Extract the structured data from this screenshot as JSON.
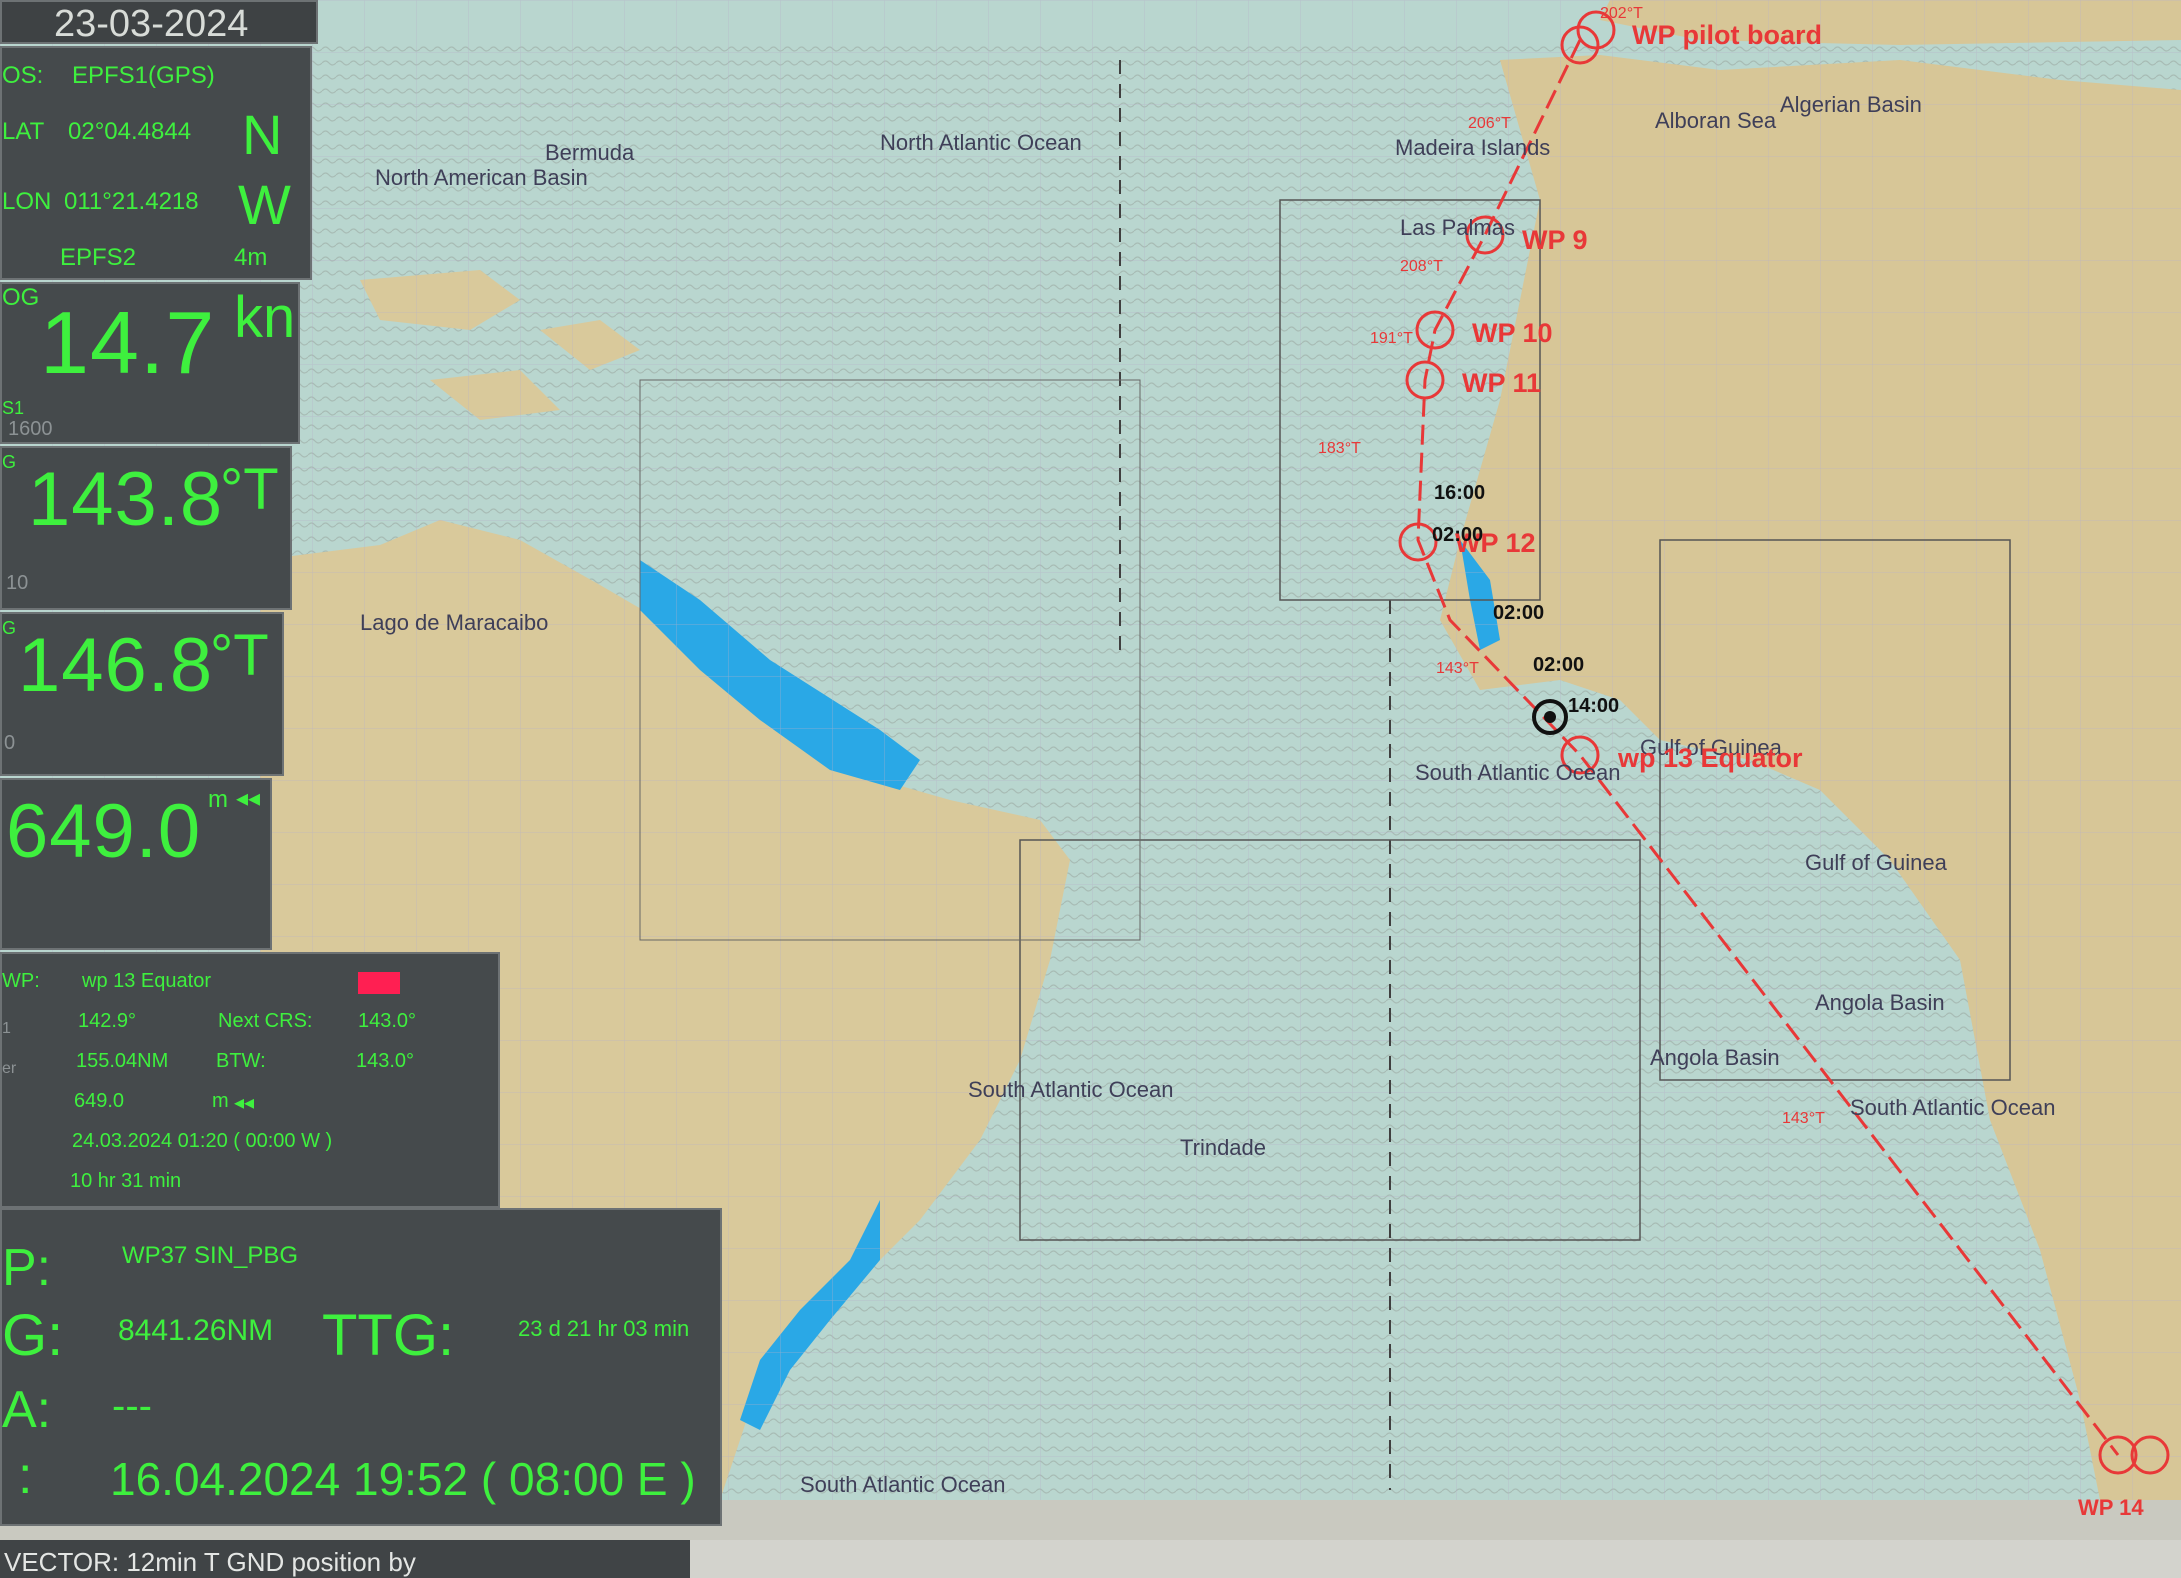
{
  "date": "23-03-2024",
  "position": {
    "pos_label": "OS:",
    "pos_source": "EPFS1(GPS)",
    "lat_label": "LAT",
    "lat_value": "02°04.4844",
    "lat_hemi": "N",
    "lon_label": "LON",
    "lon_value": "011°21.4218",
    "lon_hemi": "W",
    "secondary_source": "EPFS2",
    "secondary_offset": "4m"
  },
  "sog": {
    "label": "OG",
    "value": "14.7",
    "unit": "kn",
    "source": "S1",
    "faint": "1600"
  },
  "cog": {
    "label": "G",
    "value": "143.8",
    "unit": "°T",
    "faint": "10"
  },
  "heading": {
    "label": "G",
    "value": "146.8",
    "unit": "°T",
    "faint": "0"
  },
  "depth": {
    "value": "649.0",
    "unit": "m",
    "arrow": "◂◂"
  },
  "wp_panel": {
    "wp_label": "WP:",
    "wp_name": "wp 13 Equator",
    "course": "142.9°",
    "next_crs_label": "Next CRS:",
    "next_crs": "143.0°",
    "dist": "155.04NM",
    "btw_label": "BTW:",
    "btw": "143.0°",
    "depth": "649.0",
    "depth_unit": "m",
    "depth_arrow": "◂◂",
    "eta": "24.03.2024 01:20 ( 00:00 W )",
    "ttg": "10 hr 31 min",
    "row_label_1": "1",
    "row_label_2": "er",
    "alarm_color": "#ff1f52"
  },
  "dest_panel": {
    "wp_label": "P:",
    "wp_name": "WP37 SIN_PBG",
    "dtg_label": "G:",
    "dtg": "8441.26NM",
    "ttg_label": "TTG:",
    "ttg": "23 d 21 hr 03 min",
    "a_label": "A:",
    "a_value": "---",
    "eta_label": ":",
    "eta": "16.04.2024 19:52 ( 08:00 E )"
  },
  "status_bar": {
    "text": "VECTOR: 12min T GND    position by"
  },
  "route": {
    "waypoints": [
      "WP pilot board",
      "WP 9",
      "WP 10",
      "WP 11",
      "WP 12",
      "wp 13 Equator",
      "WP 14"
    ],
    "bearings": [
      "202°T",
      "206°T",
      "208°T",
      "191°T",
      "183°T",
      "143°T",
      "143°T"
    ],
    "times": [
      "16:00",
      "02:00",
      "02:00",
      "02:00",
      "14:00"
    ],
    "route_color": "#e83838"
  },
  "map_labels": [
    "Bermuda",
    "North American Basin",
    "North Atlantic Ocean",
    "Madeira Islands",
    "Las Palmas",
    "Alboran Sea",
    "Algerian Basin",
    "Lago de Maracaibo",
    "Gulf of Guinea",
    "South Atlantic Ocean",
    "Gulf of Guinea",
    "Angola Basin",
    "Angola Basin",
    "South Atlantic Ocean",
    "South Atlantic Ocean",
    "Trindade",
    "South Atlantic Ocean"
  ]
}
